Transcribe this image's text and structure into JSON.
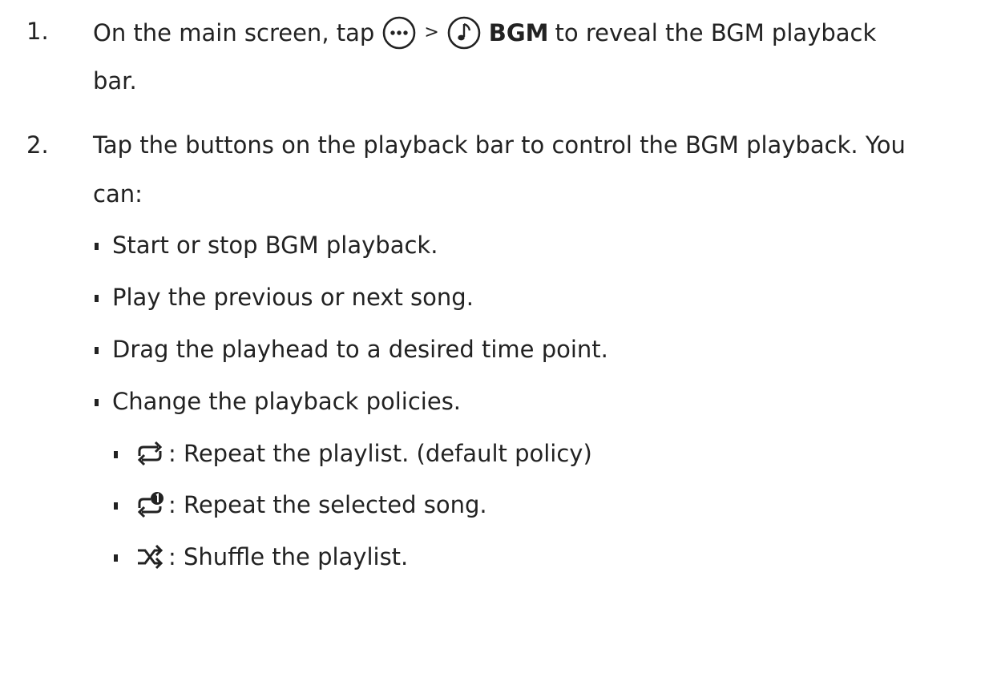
{
  "steps": [
    {
      "number": "1.",
      "text_a": "On the main screen, tap",
      "sep": ">",
      "bold": "BGM",
      "text_b": "to reveal the BGM playback",
      "text_cont": "bar.",
      "icons": [
        "more-options-icon",
        "music-note-icon"
      ]
    },
    {
      "number": "2.",
      "text": "Tap the buttons on the playback bar to control the BGM playback. You",
      "text_cont": "can:",
      "bullets": [
        "Start or stop BGM playback.",
        "Play the previous or next song.",
        "Drag the playhead to a desired time point.",
        "Change the playback policies."
      ],
      "policies": [
        {
          "icon": "repeat-all-icon",
          "text": ": Repeat the playlist. (default policy)"
        },
        {
          "icon": "repeat-one-icon",
          "text": ": Repeat the selected song."
        },
        {
          "icon": "shuffle-icon",
          "text": ": Shuffle the playlist."
        }
      ]
    }
  ],
  "colors": {
    "text": "#222222",
    "background": "#ffffff"
  }
}
